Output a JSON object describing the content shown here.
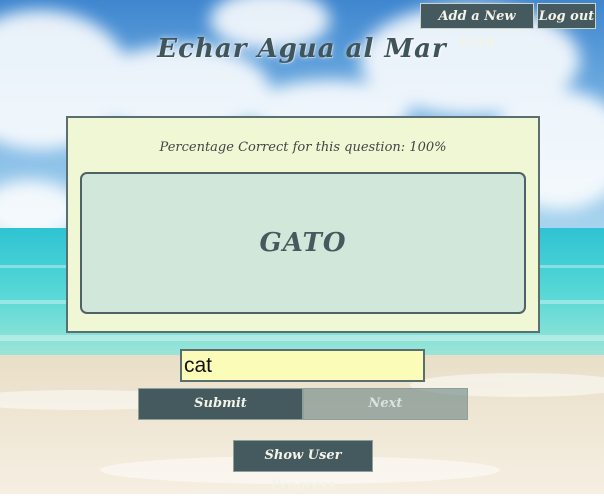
{
  "header": {
    "add_card_label": "Add a New Card",
    "logout_label": "Log out",
    "app_title": "Echar Agua al Mar"
  },
  "quiz": {
    "percentage_text": "Percentage Correct for this question: 100%",
    "card_word": "GATO",
    "answer_value": "cat",
    "submit_label": "Submit",
    "next_label": "Next"
  },
  "footer": {
    "progress_label": "Show User Progress"
  },
  "colors": {
    "button_dark": "#455a5e",
    "panel_bg": "#f0f7d4",
    "card_bg": "#d1e7d9",
    "input_bg": "#fafcb8"
  }
}
